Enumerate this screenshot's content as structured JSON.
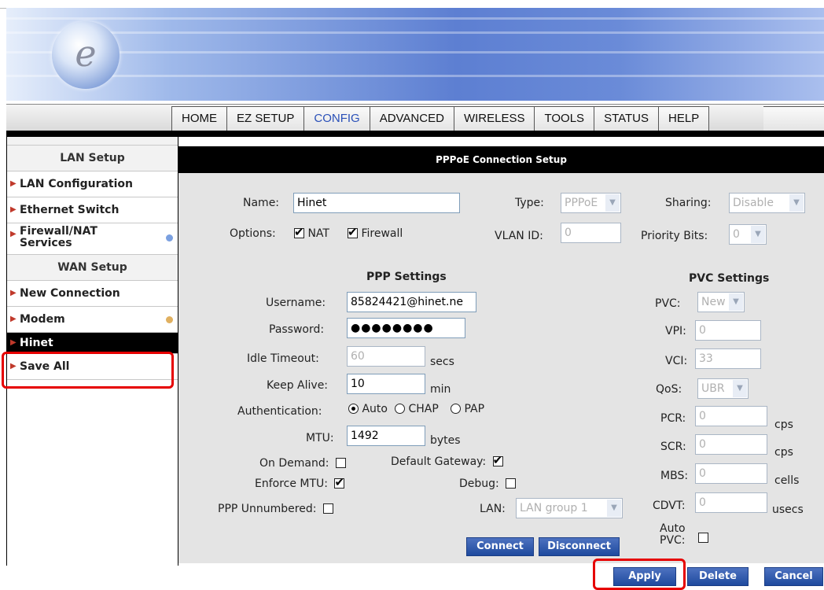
{
  "logo": {
    "letter": "e"
  },
  "nav": {
    "tabs": [
      "HOME",
      "EZ SETUP",
      "CONFIG",
      "ADVANCED",
      "WIRELESS",
      "TOOLS",
      "STATUS",
      "HELP"
    ],
    "active": "CONFIG"
  },
  "sidebar": {
    "lan_header": "LAN Setup",
    "wan_header": "WAN Setup",
    "items": {
      "lan_configuration": "LAN Configuration",
      "ethernet_switch": "Ethernet Switch",
      "firewall_nat_1": "Firewall/NAT",
      "firewall_nat_2": "Services",
      "new_connection": "New Connection",
      "modem": "Modem",
      "hinet": "Hinet",
      "save_all": "Save All"
    },
    "dot_colors": {
      "firewall": "#7aa0e0",
      "modem": "#e0b060"
    }
  },
  "main": {
    "title": "PPPoE Connection Setup",
    "name_label": "Name:",
    "name_value": "Hinet",
    "type_label": "Type:",
    "type_value": "PPPoE",
    "sharing_label": "Sharing:",
    "sharing_value": "Disable",
    "options_label": "Options:",
    "nat_label": "NAT",
    "firewall_label": "Firewall",
    "vlan_label": "VLAN ID:",
    "vlan_value": "0",
    "priority_label": "Priority Bits:",
    "priority_value": "0",
    "ppp_settings": "PPP Settings",
    "pvc_settings": "PVC Settings",
    "username_label": "Username:",
    "username_value": "85824421@hinet.ne",
    "password_label": "Password:",
    "password_value": "●●●●●●●●",
    "idle_label": "Idle Timeout:",
    "idle_value": "60",
    "idle_unit": "secs",
    "keep_label": "Keep Alive:",
    "keep_value": "10",
    "keep_unit": "min",
    "auth_label": "Authentication:",
    "auth_auto": "Auto",
    "auth_chap": "CHAP",
    "auth_pap": "PAP",
    "mtu_label": "MTU:",
    "mtu_value": "1492",
    "mtu_unit": "bytes",
    "ondemand_label": "On Demand:",
    "default_gw_label": "Default Gateway:",
    "enforce_label": "Enforce MTU:",
    "debug_label": "Debug:",
    "unnumbered_label": "PPP Unnumbered:",
    "lan_label": "LAN:",
    "lan_value": "LAN group 1",
    "pvc_label": "PVC:",
    "pvc_value": "New",
    "vpi_label": "VPI:",
    "vpi_value": "0",
    "vci_label": "VCI:",
    "vci_value": "33",
    "qos_label": "QoS:",
    "qos_value": "UBR",
    "pcr_label": "PCR:",
    "pcr_value": "0",
    "pcr_unit": "cps",
    "scr_label": "SCR:",
    "scr_value": "0",
    "scr_unit": "cps",
    "mbs_label": "MBS:",
    "mbs_value": "0",
    "mbs_unit": "cells",
    "cdvt_label": "CDVT:",
    "cdvt_value": "0",
    "cdvt_unit": "usecs",
    "autopvc_label_1": "Auto",
    "autopvc_label_2": "PVC:",
    "connect": "Connect",
    "disconnect": "Disconnect"
  },
  "actions": {
    "apply": "Apply",
    "delete": "Delete",
    "cancel": "Cancel"
  }
}
